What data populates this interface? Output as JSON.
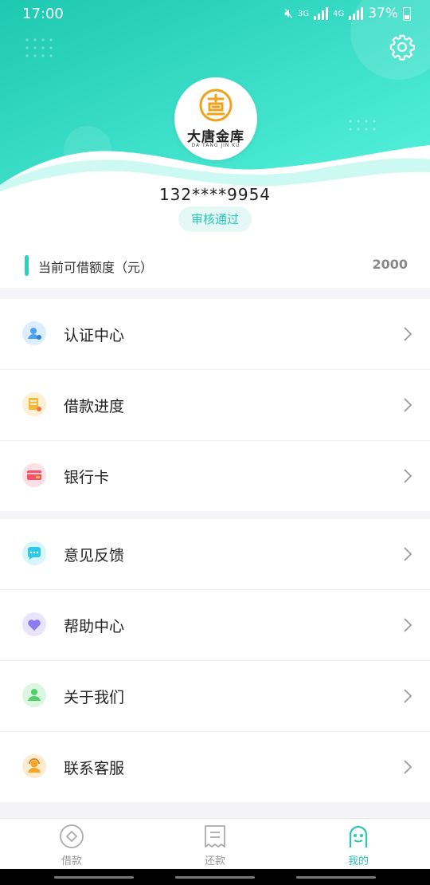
{
  "status_bar": {
    "time": "17:00",
    "net1": "3G",
    "net2": "4G",
    "battery": "37%"
  },
  "profile": {
    "brand_cn": "大唐金库",
    "brand_en": "DA TANG JIN KU",
    "phone": "132****9954",
    "badge": "审核通过"
  },
  "credit": {
    "label": "当前可借额度（元）",
    "amount": "2000"
  },
  "menu_group_1": [
    {
      "label": "认证中心",
      "icon": "certification-icon",
      "color": "#4aa3f0"
    },
    {
      "label": "借款进度",
      "icon": "loan-progress-icon",
      "color": "#f5b93a"
    },
    {
      "label": "银行卡",
      "icon": "bank-card-icon",
      "color": "#f2526b"
    }
  ],
  "menu_group_2": [
    {
      "label": "意见反馈",
      "icon": "feedback-icon",
      "color": "#2ec9e8"
    },
    {
      "label": "帮助中心",
      "icon": "help-heart-icon",
      "color": "#8a7cf0"
    },
    {
      "label": "关于我们",
      "icon": "about-us-icon",
      "color": "#4fd06a"
    },
    {
      "label": "联系客服",
      "icon": "customer-service-icon",
      "color": "#f5a623"
    }
  ],
  "tabs": [
    {
      "label": "借款",
      "icon": "borrow-icon",
      "active": false
    },
    {
      "label": "还款",
      "icon": "repay-icon",
      "active": false
    },
    {
      "label": "我的",
      "icon": "mine-icon",
      "active": true
    }
  ],
  "colors": {
    "accent": "#2cc6b6",
    "header_gradient_start": "#17c7b0",
    "header_gradient_end": "#4ef0d6"
  }
}
